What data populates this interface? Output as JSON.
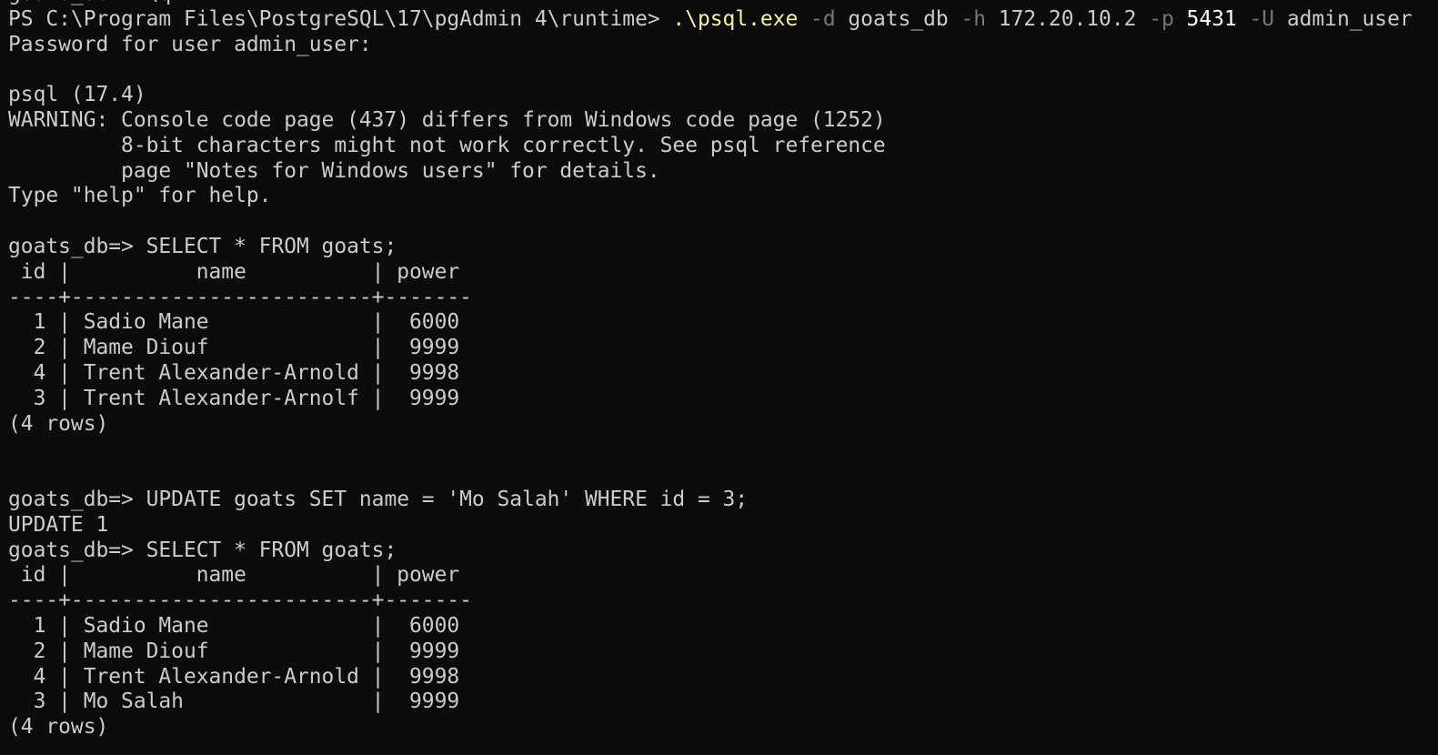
{
  "theme": {
    "background": "#0c0c0c",
    "foreground": "#cccccc",
    "command_color": "#f9f1a5",
    "flag_color": "#767676",
    "number_color": "#ffffff"
  },
  "terminal": {
    "lines": [
      {
        "segments": [
          {
            "text": "goats_db-> \\q",
            "style": "default"
          }
        ]
      },
      {
        "segments": [
          {
            "text": "PS C:\\Program Files\\PostgreSQL\\17\\pgAdmin 4\\runtime> ",
            "style": "default"
          },
          {
            "text": ".\\psql.exe",
            "style": "cmd"
          },
          {
            "text": " -d",
            "style": "flag"
          },
          {
            "text": " goats_db",
            "style": "default"
          },
          {
            "text": " -h",
            "style": "flag"
          },
          {
            "text": " 172.20.10.2",
            "style": "default"
          },
          {
            "text": " -p",
            "style": "flag"
          },
          {
            "text": " 5431",
            "style": "num"
          },
          {
            "text": " -U",
            "style": "flag"
          },
          {
            "text": " admin_user",
            "style": "default"
          }
        ]
      },
      {
        "segments": [
          {
            "text": "Password for user admin_user:",
            "style": "default"
          }
        ]
      },
      {
        "segments": [
          {
            "text": "",
            "style": "default"
          }
        ]
      },
      {
        "segments": [
          {
            "text": "psql (17.4)",
            "style": "default"
          }
        ]
      },
      {
        "segments": [
          {
            "text": "WARNING: Console code page (437) differs from Windows code page (1252)",
            "style": "default"
          }
        ]
      },
      {
        "segments": [
          {
            "text": "         8-bit characters might not work correctly. See psql reference",
            "style": "default"
          }
        ]
      },
      {
        "segments": [
          {
            "text": "         page \"Notes for Windows users\" for details.",
            "style": "default"
          }
        ]
      },
      {
        "segments": [
          {
            "text": "Type \"help\" for help.",
            "style": "default"
          }
        ]
      },
      {
        "segments": [
          {
            "text": "",
            "style": "default"
          }
        ]
      },
      {
        "segments": [
          {
            "text": "goats_db=> SELECT * FROM goats;",
            "style": "default"
          }
        ]
      },
      {
        "segments": [
          {
            "text": " id |          name          | power",
            "style": "default"
          }
        ]
      },
      {
        "segments": [
          {
            "text": "----+------------------------+-------",
            "style": "default"
          }
        ]
      },
      {
        "segments": [
          {
            "text": "  1 | Sadio Mane             |  6000",
            "style": "default"
          }
        ]
      },
      {
        "segments": [
          {
            "text": "  2 | Mame Diouf             |  9999",
            "style": "default"
          }
        ]
      },
      {
        "segments": [
          {
            "text": "  4 | Trent Alexander-Arnold |  9998",
            "style": "default"
          }
        ]
      },
      {
        "segments": [
          {
            "text": "  3 | Trent Alexander-Arnolf |  9999",
            "style": "default"
          }
        ]
      },
      {
        "segments": [
          {
            "text": "(4 rows)",
            "style": "default"
          }
        ]
      },
      {
        "segments": [
          {
            "text": "",
            "style": "default"
          }
        ]
      },
      {
        "segments": [
          {
            "text": "",
            "style": "default"
          }
        ]
      },
      {
        "segments": [
          {
            "text": "goats_db=> UPDATE goats SET name = 'Mo Salah' WHERE id = 3;",
            "style": "default"
          }
        ]
      },
      {
        "segments": [
          {
            "text": "UPDATE 1",
            "style": "default"
          }
        ]
      },
      {
        "segments": [
          {
            "text": "goats_db=> SELECT * FROM goats;",
            "style": "default"
          }
        ]
      },
      {
        "segments": [
          {
            "text": " id |          name          | power",
            "style": "default"
          }
        ]
      },
      {
        "segments": [
          {
            "text": "----+------------------------+-------",
            "style": "default"
          }
        ]
      },
      {
        "segments": [
          {
            "text": "  1 | Sadio Mane             |  6000",
            "style": "default"
          }
        ]
      },
      {
        "segments": [
          {
            "text": "  2 | Mame Diouf             |  9999",
            "style": "default"
          }
        ]
      },
      {
        "segments": [
          {
            "text": "  4 | Trent Alexander-Arnold |  9998",
            "style": "default"
          }
        ]
      },
      {
        "segments": [
          {
            "text": "  3 | Mo Salah               |  9999",
            "style": "default"
          }
        ]
      },
      {
        "segments": [
          {
            "text": "(4 rows)",
            "style": "default"
          }
        ]
      }
    ]
  }
}
